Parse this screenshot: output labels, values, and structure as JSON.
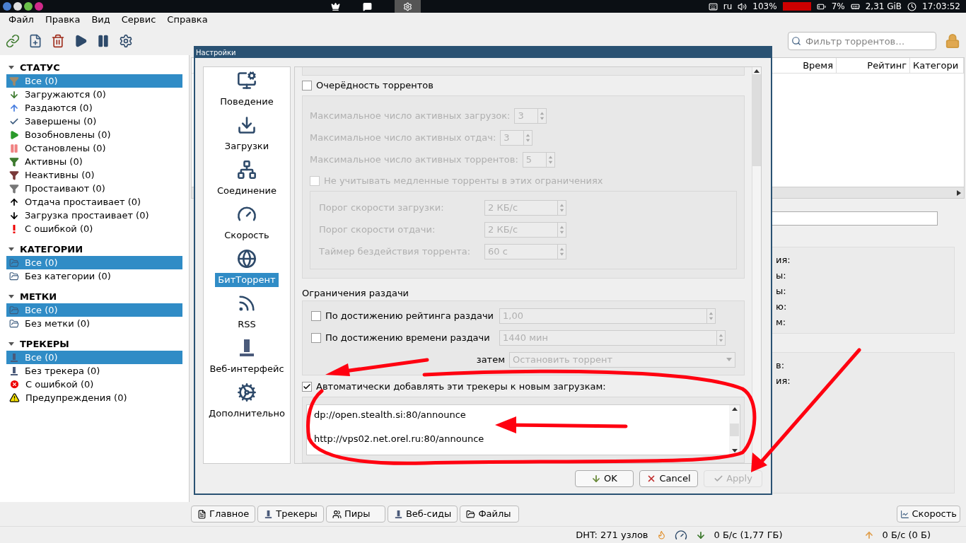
{
  "top_panel": {
    "keyboard_layout": "ru",
    "volume": "103%",
    "battery": "7%",
    "memory": "2,31 GiB",
    "clock": "17:03:52"
  },
  "menu": [
    "Файл",
    "Правка",
    "Вид",
    "Сервис",
    "Справка"
  ],
  "search": {
    "placeholder": "Фильтр торрентов…"
  },
  "sidebar": [
    {
      "title": "СТАТУС",
      "expanded": true,
      "items": [
        {
          "label": "Все (0)",
          "kind": "all",
          "selected": true
        },
        {
          "label": "Загружаются (0)",
          "kind": "downloading",
          "selected": false
        },
        {
          "label": "Раздаются (0)",
          "kind": "seeding",
          "selected": false
        },
        {
          "label": "Завершены (0)",
          "kind": "completed",
          "selected": false
        },
        {
          "label": "Возобновлены (0)",
          "kind": "resumed",
          "selected": false
        },
        {
          "label": "Остановлены (0)",
          "kind": "paused",
          "selected": false
        },
        {
          "label": "Активны (0)",
          "kind": "active",
          "selected": false
        },
        {
          "label": "Неактивны (0)",
          "kind": "inactive",
          "selected": false
        },
        {
          "label": "Простаивают (0)",
          "kind": "stalled",
          "selected": false
        },
        {
          "label": "Отдача простаивает (0)",
          "kind": "stalled_up",
          "selected": false
        },
        {
          "label": "Загрузка простаивает (0)",
          "kind": "stalled_down",
          "selected": false
        },
        {
          "label": "С ошибкой (0)",
          "kind": "error",
          "selected": false
        }
      ]
    },
    {
      "title": "КАТЕГОРИИ",
      "expanded": true,
      "items": [
        {
          "label": "Все (0)",
          "kind": "folder",
          "selected": true
        },
        {
          "label": "Без категории (0)",
          "kind": "folder",
          "selected": false
        }
      ]
    },
    {
      "title": "МЕТКИ",
      "expanded": true,
      "items": [
        {
          "label": "Все (0)",
          "kind": "folder",
          "selected": true
        },
        {
          "label": "Без метки (0)",
          "kind": "folder",
          "selected": false
        }
      ]
    },
    {
      "title": "ТРЕКЕРЫ",
      "expanded": true,
      "items": [
        {
          "label": "Все (0)",
          "kind": "tracker",
          "selected": true
        },
        {
          "label": "Без трекера (0)",
          "kind": "tracker",
          "selected": false
        },
        {
          "label": "С ошибкой (0)",
          "kind": "tracker_error",
          "selected": false
        },
        {
          "label": "Предупреждения (0)",
          "kind": "warning",
          "selected": false
        }
      ]
    }
  ],
  "table": {
    "columns": [
      "Время",
      "Рейтинг",
      "Категори"
    ]
  },
  "details": {
    "group_1": [
      "ия:",
      "ы:",
      "ы:",
      "ю:",
      "м:"
    ],
    "group_2": [
      "в:",
      "ия:"
    ]
  },
  "dialog": {
    "title": "Настройки",
    "nav": [
      {
        "label": "Поведение",
        "kind": "behavior",
        "selected": false
      },
      {
        "label": "Загрузки",
        "kind": "downloads",
        "selected": false
      },
      {
        "label": "Соединение",
        "kind": "connection",
        "selected": false
      },
      {
        "label": "Скорость",
        "kind": "speed",
        "selected": false
      },
      {
        "label": "БитТоррент",
        "kind": "bittorrent",
        "selected": true
      },
      {
        "label": "RSS",
        "kind": "rss",
        "selected": false
      },
      {
        "label": "Веб-интерфейс",
        "kind": "webui",
        "selected": false
      },
      {
        "label": "Дополнительно",
        "kind": "advanced",
        "selected": false
      }
    ],
    "queue": {
      "label": "Очерёдность торрентов",
      "checked": false,
      "rows": [
        {
          "label": "Максимальное число активных загрузок:",
          "value": "3"
        },
        {
          "label": "Максимальное число активных отдач:",
          "value": "3"
        },
        {
          "label": "Максимальное число активных торрентов:",
          "value": "5"
        }
      ],
      "slow": {
        "label": "Не учитывать медленные торренты в этих ограничениях",
        "checked": false
      },
      "slow_rows": [
        {
          "label": "Порог скорости загрузки:",
          "value": "2 КБ/с"
        },
        {
          "label": "Порог скорости отдачи:",
          "value": "2 КБ/с"
        },
        {
          "label": "Таймер бездействия торрента:",
          "value": "60 с"
        }
      ]
    },
    "share_limits": {
      "title": "Ограничения раздачи",
      "rows": [
        {
          "label": "По достижению рейтинга раздачи",
          "checked": false,
          "value": "1,00"
        },
        {
          "label": "По достижению времени раздачи",
          "checked": false,
          "value": "1440 мин"
        }
      ],
      "then_label": "затем",
      "then_value": "Остановить торрент"
    },
    "trackers": {
      "label": "Автоматически добавлять эти трекеры к новым загрузкам:",
      "checked": true,
      "lines": [
        "dp://open.stealth.si:80/announce",
        "http://vps02.net.orel.ru:80/announce"
      ]
    },
    "buttons": [
      {
        "label": "OK",
        "kind": "ok",
        "disabled": false
      },
      {
        "label": "Cancel",
        "kind": "cancel",
        "disabled": false
      },
      {
        "label": "Apply",
        "kind": "apply",
        "disabled": true
      }
    ]
  },
  "bottom_tabs": [
    "Главное",
    "Трекеры",
    "Пиры",
    "Веб-сиды",
    "Файлы"
  ],
  "speed_button": "Скорость",
  "status_bar": {
    "dht": "DHT: 271 узлов",
    "download": "0 Б/с (1,77 ГБ)",
    "upload": "0 Б/с (0 Б)"
  }
}
